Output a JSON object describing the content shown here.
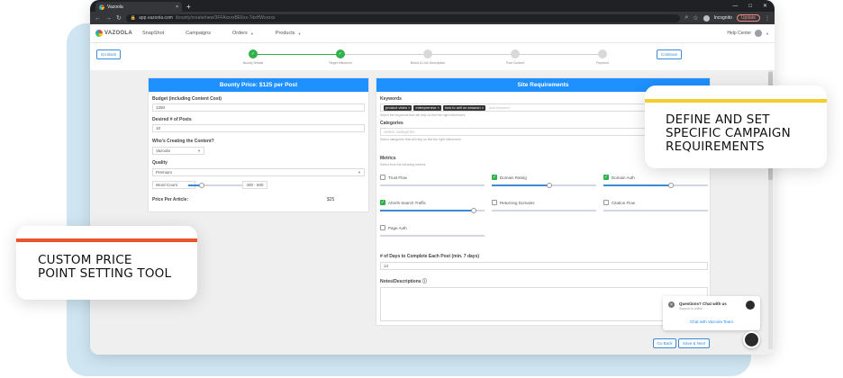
{
  "browser": {
    "tab_title": "Vazoola",
    "tab_close": "×",
    "new_tab": "+",
    "window_controls": [
      "—",
      "□",
      "✕"
    ],
    "url_host": "app.vazoola.com",
    "url_path": "/bounty/create/new/3FFAxxxxBE6xx-7dxHWxxxxx",
    "incognito_label": "Incognito",
    "update_label": "Update"
  },
  "appnav": {
    "logo_text": "VAZOOLA",
    "items": [
      {
        "label": "SnapShot",
        "dropdown": false
      },
      {
        "label": "Campaigns",
        "dropdown": false
      },
      {
        "label": "Orders",
        "dropdown": true
      },
      {
        "label": "Products",
        "dropdown": true
      }
    ],
    "help_label": "Help Center"
  },
  "steps": {
    "go_back": "Go Back",
    "continue": "Continue",
    "items": [
      {
        "label": "Bounty Details",
        "done": true
      },
      {
        "label": "Target Influencer",
        "done": true
      },
      {
        "label": "Brand & Link Description",
        "done": false
      },
      {
        "label": "Post Content",
        "done": false
      },
      {
        "label": "Payment",
        "done": false
      }
    ]
  },
  "left_panel": {
    "header": "Bounty Price:  $125 per Post",
    "budget_label": "Budget (including Content Cost)",
    "budget_value": "1250",
    "posts_label": "Desired # of Posts",
    "posts_value": "10",
    "creator_label": "Who's Creating the Content?",
    "creator_value": "Vazoola",
    "quality_label": "Quality",
    "quality_value": "Premium",
    "word_count_label": "Word Count",
    "word_count_range": "400 - 500",
    "word_count_fill": 0.25,
    "price_label": "Price Per Article:",
    "price_value": "$25"
  },
  "right_panel": {
    "header": "Site Requirements",
    "keywords_label": "Keywords",
    "keywords": [
      "product video",
      "entrepreneur",
      "how to sell on amazon"
    ],
    "keywords_placeholder": "add keyword",
    "keywords_hint": "Select the keywords that will help us find the right influencers",
    "categories_label": "Categories",
    "categories_placeholder": "Select categories",
    "categories_hint": "Select categories that will help us find the right influencers",
    "metrics_label": "Metrics",
    "metrics_hint": "Select from the following metrics",
    "metrics": [
      {
        "label": "Trust Flow",
        "checked": false,
        "fill": 0.0
      },
      {
        "label": "Domain Rating",
        "checked": true,
        "fill": 0.55
      },
      {
        "label": "Domain Auth",
        "checked": true,
        "fill": 0.65
      },
      {
        "label": "Ahrefs Search Traffic",
        "checked": true,
        "fill": 0.9
      },
      {
        "label": "Returning Domains",
        "checked": false,
        "fill": 0.0
      },
      {
        "label": "Citation Flow",
        "checked": false,
        "fill": 0.0
      },
      {
        "label": "Page Auth",
        "checked": false,
        "fill": 0.0
      }
    ],
    "days_label": "# of Days to Complete Each Post (min. 7 days)",
    "days_value": "14",
    "notes_label": "Notes/Descriptions",
    "notes_icon": "info-icon"
  },
  "bottom_buttons": {
    "go_back": "Go Back",
    "save_next": "Save & Next"
  },
  "chat": {
    "title": "Questions? Chat with us",
    "subtitle": "Support is online",
    "link": "Chat with Vazoola Team",
    "close": "×"
  },
  "callouts": {
    "right_text": "DEFINE AND SET\nSPECIFIC CAMPAIGN\nREQUIREMENTS",
    "left_text": "CUSTOM PRICE\nPOINT SETTING TOOL"
  },
  "colors": {
    "accent_blue": "#1e90ff",
    "success_green": "#2fb14b",
    "callout_yellow": "#f2cf2c",
    "callout_orange": "#e8542c",
    "backdrop": "#cfe6f2"
  }
}
